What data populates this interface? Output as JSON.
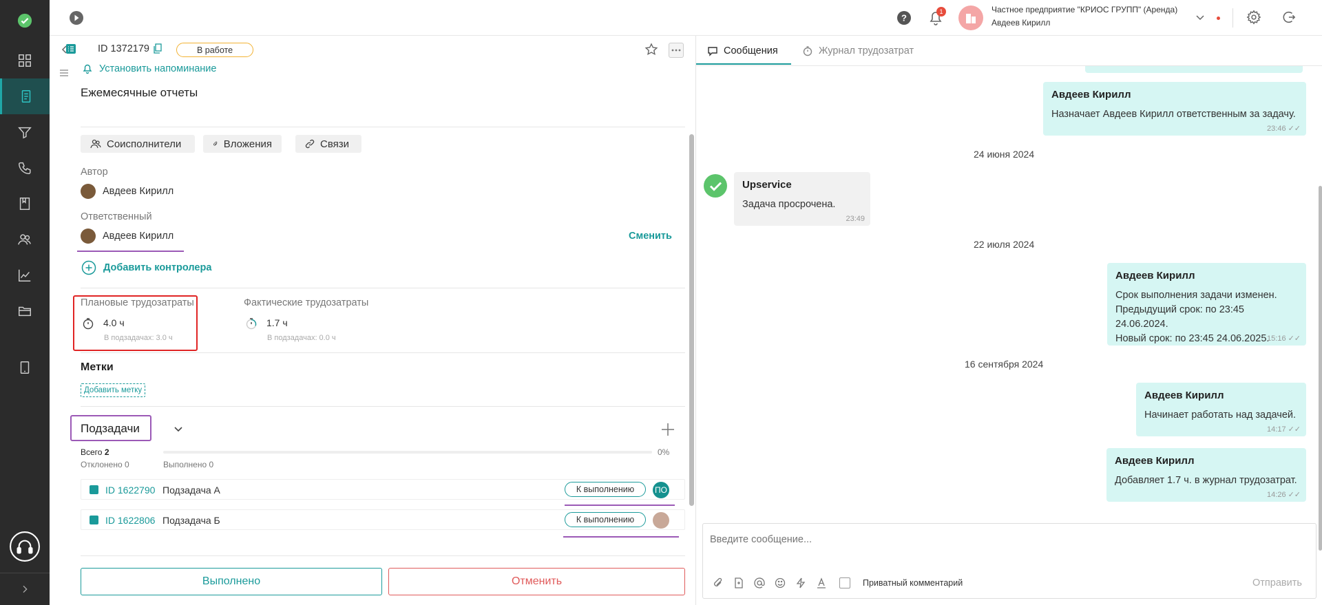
{
  "topbar": {
    "notif_count": "1",
    "org_name": "Частное предприятие \"КРИОС ГРУПП\" (Аренда)",
    "user_name": "Авдеев Кирилл"
  },
  "task": {
    "id": "ID 1372179",
    "status": "В работе",
    "reminder": "Установить напоминание",
    "title": "Ежемесячные отчеты",
    "buttons": {
      "coexecutors": "Соисполнители",
      "attachments": "Вложения",
      "links": "Связи"
    },
    "author_label": "Автор",
    "author_name": "Авдеев Кирилл",
    "responsible_label": "Ответственный",
    "responsible_name": "Авдеев Кирилл",
    "change_label": "Сменить",
    "add_controller": "Добавить контролера",
    "planned_label": "Плановые трудозатраты",
    "planned_value": "4.0 ч",
    "planned_sub": "В подзадачах: 3.0 ч",
    "actual_label": "Фактические трудозатраты",
    "actual_value": "1.7 ч",
    "actual_sub": "В подзадачах: 0.0 ч",
    "tags_label": "Метки",
    "add_tag": "Добавить метку",
    "subtasks_label": "Подзадачи",
    "total_label": "Всего",
    "total_value": "2",
    "rejected": "Отклонено 0",
    "done": "Выполнено 0",
    "progress_pct": "0%",
    "progress_fraction": 0,
    "subtasks": [
      {
        "id": "ID 1622790",
        "name": "Подзадача А",
        "status": "К выполнению",
        "avatar": "ПО"
      },
      {
        "id": "ID 1622806",
        "name": "Подзадача Б",
        "status": "К выполнению",
        "avatar": ""
      }
    ],
    "done_button": "Выполнено",
    "cancel_button": "Отменить"
  },
  "chat": {
    "tabs": {
      "messages": "Сообщения",
      "journal": "Журнал трудозатрат"
    },
    "messages": [
      {
        "name": "Авдеев Кирилл",
        "text": "Назначает Авдеев Кирилл ответственным за задачу.",
        "time": "23:46"
      },
      {
        "date": "24 июня 2024"
      },
      {
        "name": "Upservice",
        "text": "Задача просрочена.",
        "time": "23:49"
      },
      {
        "date": "22 июля 2024"
      },
      {
        "name": "Авдеев Кирилл",
        "line1": "Срок выполнения задачи изменен.",
        "line2": "Предыдущий срок: по 23:45 24.06.2024.",
        "line3": "Новый срок: по 23:45 24.06.2025.",
        "time": "15:16"
      },
      {
        "date": "16 сентября 2024"
      },
      {
        "name": "Авдеев Кирилл",
        "text": "Начинает работать над задачей.",
        "time": "14:17"
      },
      {
        "name": "Авдеев Кирилл",
        "text": "Добавляет 1.7 ч. в журнал трудозатрат.",
        "time": "14:26"
      }
    ],
    "input_placeholder": "Введите сообщение...",
    "private_comment": "Приватный комментарий",
    "send": "Отправить"
  },
  "colors": {
    "accent": "#1a9a9a",
    "sidebar": "#2b2b2b",
    "bubble_out": "#d6f6f3",
    "cancel": "#e05a5a",
    "highlight_purple": "#9b59b6",
    "highlight_red": "#e02424"
  }
}
